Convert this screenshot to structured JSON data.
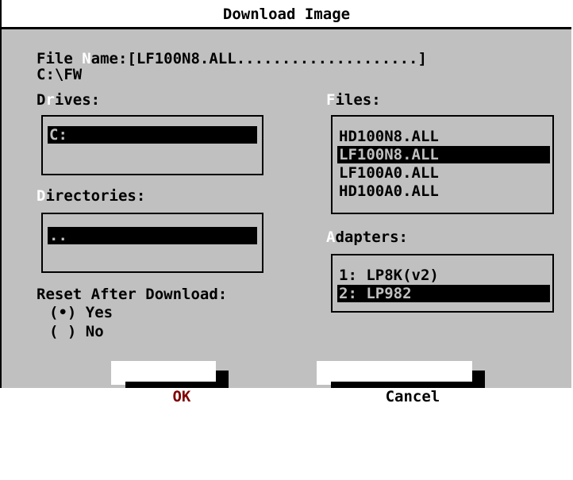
{
  "dialog": {
    "title": "Download Image",
    "file_name": {
      "label_prefix": "File ",
      "hotkey": "N",
      "label_suffix": "ame:",
      "value": "[LF100N8.ALL",
      "fill": "....................]"
    },
    "current_path": "C:\\FW",
    "drives": {
      "label_prefix": "D",
      "hotkey": "r",
      "label_suffix": "ives:",
      "items": [
        "C:"
      ],
      "selected_index": 0
    },
    "directories": {
      "hotkey": "D",
      "label_suffix": "irectories:",
      "items": [
        ".."
      ],
      "selected_index": 0
    },
    "files": {
      "hotkey": "F",
      "label_suffix": "iles:",
      "items": [
        "HD100N8.ALL",
        "LF100N8.ALL",
        "LF100A0.ALL",
        "HD100A0.ALL"
      ],
      "selected_index": 1
    },
    "adapters": {
      "hotkey": "A",
      "label_suffix": "dapters:",
      "items": [
        "1: LP8K(v2)",
        "2: LP982"
      ],
      "selected_index": 1
    },
    "reset_after_download": {
      "label": "Reset After Download:",
      "options": [
        {
          "marker": "(•)",
          "label": "Yes",
          "selected": true
        },
        {
          "marker": "( )",
          "label": "No",
          "selected": false
        }
      ]
    },
    "buttons": {
      "ok": "OK",
      "cancel": "Cancel"
    },
    "colors": {
      "background": "#c0c0c0",
      "selection": "#000000",
      "hotkey": "#ffffff",
      "ok_text": "#800000"
    }
  }
}
